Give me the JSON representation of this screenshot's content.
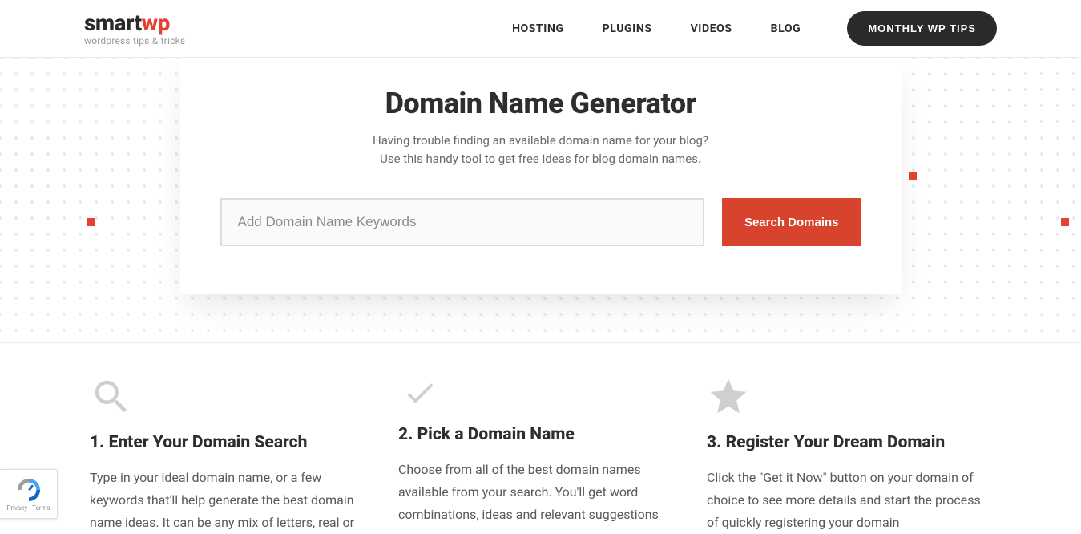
{
  "header": {
    "logo_smart": "smart",
    "logo_wp": "wp",
    "tagline": "wordpress tips & tricks",
    "nav": [
      "HOSTING",
      "PLUGINS",
      "VIDEOS",
      "BLOG"
    ],
    "cta": "MONTHLY WP TIPS"
  },
  "generator": {
    "title": "Domain Name Generator",
    "sub_line1": "Having trouble finding an available domain name for your blog?",
    "sub_line2": "Use this handy tool to get free ideas for blog domain names.",
    "placeholder": "Add Domain Name Keywords",
    "button": "Search Domains"
  },
  "steps": [
    {
      "title": "1. Enter Your Domain Search",
      "text": "Type in your ideal domain name, or a few keywords that'll help generate the best domain name ideas. It can be any mix of letters, real or"
    },
    {
      "title": "2. Pick a Domain Name",
      "text": "Choose from all of the best domain names available from your search. You'll get word combinations, ideas and relevant suggestions"
    },
    {
      "title": "3. Register Your Dream Domain",
      "text": "Click the \"Get it Now\" button on your domain of choice to see more details and start the process of quickly registering your domain"
    }
  ],
  "recaptcha": {
    "links": "Privacy - Terms"
  }
}
